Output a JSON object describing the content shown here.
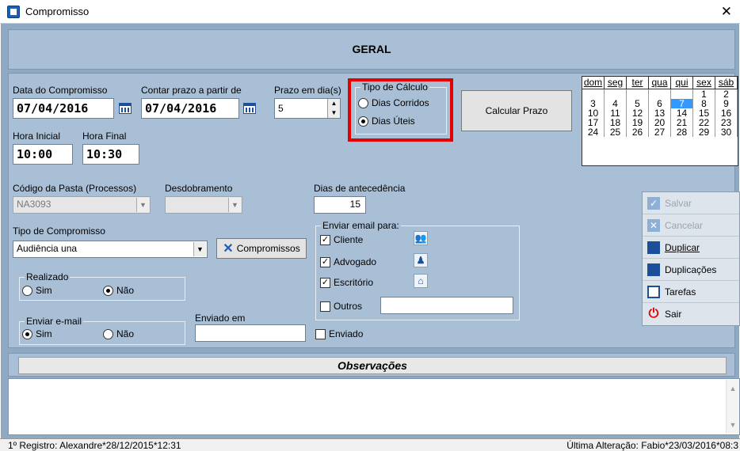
{
  "window": {
    "title": "Compromisso"
  },
  "header": {
    "title": "GERAL"
  },
  "dates": {
    "data_label": "Data do Compromisso",
    "data_value": "07/04/2016",
    "contar_label": "Contar prazo a partir de",
    "contar_value": "07/04/2016",
    "prazo_label": "Prazo em dia(s)",
    "prazo_value": "5",
    "hora_inicial_label": "Hora Inicial",
    "hora_inicial_value": "10:00",
    "hora_final_label": "Hora Final",
    "hora_final_value": "10:30"
  },
  "tipo_calculo": {
    "label": "Tipo de Cálculo",
    "opt1": "Dias Corridos",
    "opt2": "Dias Úteis",
    "selected": "Dias Úteis"
  },
  "calcular_button": "Calcular Prazo",
  "calendar": {
    "days": [
      "dom",
      "seg",
      "ter",
      "qua",
      "qui",
      "sex",
      "sáb"
    ],
    "weeks": [
      [
        "",
        "",
        "",
        "",
        "",
        "1",
        "2"
      ],
      [
        "3",
        "4",
        "5",
        "6",
        "7",
        "8",
        "9"
      ],
      [
        "10",
        "11",
        "12",
        "13",
        "14",
        "15",
        "16"
      ],
      [
        "17",
        "18",
        "19",
        "20",
        "21",
        "22",
        "23"
      ],
      [
        "24",
        "25",
        "26",
        "27",
        "28",
        "29",
        "30"
      ]
    ],
    "selected": "7",
    "highlight_color": "#3399ff"
  },
  "pasta": {
    "label": "Código da Pasta (Processos)",
    "value": "NA3093"
  },
  "desdobramento": {
    "label": "Desdobramento",
    "value": ""
  },
  "antecedencia": {
    "label": "Dias de antecedência",
    "value": "15"
  },
  "tipo_compromisso": {
    "label": "Tipo de Compromisso",
    "value": "Audiência una",
    "button": "Compromissos"
  },
  "realizado": {
    "label": "Realizado",
    "sim": "Sim",
    "nao": "Não",
    "selected": "Não"
  },
  "enviar_email": {
    "label": "Enviar e-mail",
    "sim": "Sim",
    "nao": "Não",
    "selected": "Sim"
  },
  "enviado_em": {
    "label": "Enviado em",
    "value": ""
  },
  "enviado_check": {
    "label": "Enviado",
    "checked": false
  },
  "email_para": {
    "label": "Enviar email para:",
    "cliente": "Cliente",
    "advogado": "Advogado",
    "escritorio": "Escritório",
    "outros": "Outros",
    "outros_value": ""
  },
  "actions": [
    {
      "label": "Salvar",
      "enabled": false,
      "icon": "checkmark-icon"
    },
    {
      "label": "Cancelar",
      "enabled": false,
      "icon": "cancel-icon"
    },
    {
      "label": "Duplicar",
      "enabled": true,
      "icon": "duplicate-icon"
    },
    {
      "label": "Duplicações",
      "enabled": true,
      "icon": "duplications-icon"
    },
    {
      "label": "Tarefas",
      "enabled": true,
      "icon": "clipboard-icon"
    },
    {
      "label": "Sair",
      "enabled": true,
      "icon": "power-icon"
    }
  ],
  "observacoes": {
    "title": "Observações",
    "text": ""
  },
  "status": {
    "left": "1º Registro: Alexandre*28/12/2015*12:31",
    "right": "Última Alteração: Fabio*23/03/2016*08:3"
  },
  "colors": {
    "frame": "#90a9c2",
    "panel": "#a9bfd6",
    "highlight_box": "#e30000"
  }
}
